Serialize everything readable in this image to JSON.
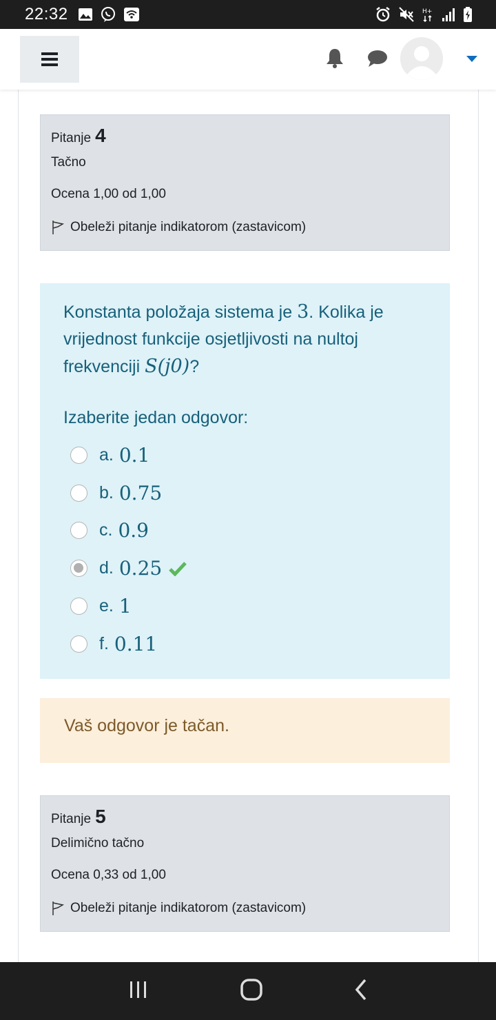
{
  "status_bar": {
    "time": "22:32"
  },
  "questions": [
    {
      "label": "Pitanje",
      "number": "4",
      "state": "Tačno",
      "grade": "Ocena 1,00 od 1,00",
      "flag": "Obeleži pitanje indikatorom (zastavicom)"
    },
    {
      "label": "Pitanje",
      "number": "5",
      "state": "Delimično tačno",
      "grade": "Ocena 0,33 od 1,00",
      "flag": "Obeleži pitanje indikatorom (zastavicom)"
    }
  ],
  "question4": {
    "text_part1": "Konstanta položaja sistema je ",
    "math_kp": "3",
    "text_part2": ". Kolika je vrijednost funkcije osjetljivosti na nultoj frekvenciji ",
    "math_s": "S(j0)",
    "text_part3": "?",
    "prompt": "Izaberite jedan odgovor:",
    "answers": [
      {
        "letter": "a.",
        "value": "0.1"
      },
      {
        "letter": "b.",
        "value": "0.75"
      },
      {
        "letter": "c.",
        "value": "0.9"
      },
      {
        "letter": "d.",
        "value": "0.25"
      },
      {
        "letter": "e.",
        "value": "1"
      },
      {
        "letter": "f.",
        "value": "0.11"
      }
    ],
    "selected_answer": "d.",
    "feedback": "Vaš odgovor je tačan."
  },
  "colors": {
    "correct_check": "#5cb85c",
    "info_bg": "#dee2e6",
    "formulation_bg": "#def2f8",
    "feedback_bg": "#fcefdc",
    "accent": "#0f6cbf"
  },
  "icons": [
    "menu-icon",
    "bell-icon",
    "chat-icon",
    "avatar-icon",
    "caret-down-icon",
    "flag-icon",
    "check-icon"
  ]
}
